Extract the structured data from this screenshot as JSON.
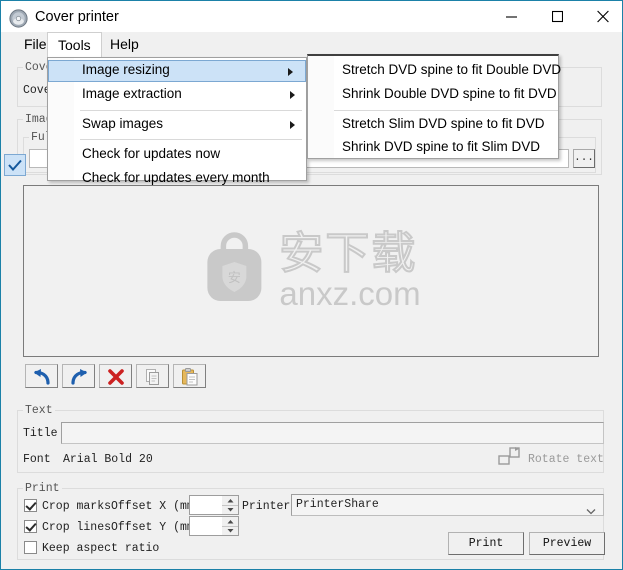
{
  "window": {
    "title": "Cover printer",
    "icon": "disc-icon",
    "border_color": "#1b81a8",
    "controls": {
      "minimize": "minimize-icon",
      "maximize": "maximize-icon",
      "close": "close-icon"
    }
  },
  "menubar": {
    "items": [
      {
        "label": "File",
        "active": false
      },
      {
        "label": "Tools",
        "active": true
      },
      {
        "label": "Help",
        "active": false
      }
    ]
  },
  "tools_menu": {
    "highlight_color": "#cce2f7",
    "items": [
      {
        "label": "Image resizing",
        "submenu": true,
        "selected": true,
        "checked": false
      },
      {
        "label": "Image extraction",
        "submenu": true,
        "selected": false,
        "checked": false
      },
      {
        "label": "Swap images",
        "submenu": true,
        "selected": false,
        "checked": false
      },
      {
        "label": "Check for updates now",
        "submenu": false,
        "selected": false,
        "checked": false
      },
      {
        "label": "Check for updates every month",
        "submenu": false,
        "selected": false,
        "checked": true
      }
    ]
  },
  "image_resizing_submenu": {
    "items": [
      {
        "label": "Stretch DVD spine to fit Double DVD"
      },
      {
        "label": "Shrink Double DVD spine to fit DVD"
      },
      {
        "label": "Stretch Slim DVD spine to fit DVD"
      },
      {
        "label": "Shrink DVD spine to fit Slim DVD"
      }
    ]
  },
  "background_groups": {
    "cover_group_label": "Cove",
    "cover_field_label": "Cove",
    "images_group_label": "Imag",
    "full_group_label": "Full",
    "browse_button_label": "..."
  },
  "canvas": {
    "watermark_cn": "安下载",
    "watermark_url": "anxz.com",
    "watermark_icon": "shield-bag-icon",
    "watermark_color": "#c9c9c9"
  },
  "editor_toolbar": {
    "buttons": [
      {
        "name": "undo-button",
        "icon": "undo-arrow-icon",
        "enabled": true
      },
      {
        "name": "redo-button",
        "icon": "redo-arrow-icon",
        "enabled": true
      },
      {
        "name": "delete-button",
        "icon": "red-x-icon",
        "enabled": true
      },
      {
        "name": "copy-button",
        "icon": "copy-icon",
        "enabled": false
      },
      {
        "name": "paste-button",
        "icon": "paste-icon",
        "enabled": true
      }
    ]
  },
  "text_group": {
    "legend": "Text",
    "title_label": "Title",
    "title_value": "",
    "title_placeholder": "",
    "font_label": "Font",
    "font_value": "Arial Bold 20",
    "rotate_text_label": "Rotate text",
    "rotate_text_enabled": false,
    "rotate_text_icon": "rotate-text-icon"
  },
  "print_group": {
    "legend": "Print",
    "crop_marks_label": "Crop marks",
    "crop_marks_checked": true,
    "crop_lines_label": "Crop lines",
    "crop_lines_checked": true,
    "keep_aspect_label": "Keep aspect ratio",
    "keep_aspect_checked": false,
    "offset_x_label": "Offset X (mm)",
    "offset_x_value": "",
    "offset_y_label": "Offset Y (mm)",
    "offset_y_value": "",
    "printer_label": "Printer",
    "printer_value": "PrinterShare",
    "print_button": "Print",
    "preview_button": "Preview"
  }
}
